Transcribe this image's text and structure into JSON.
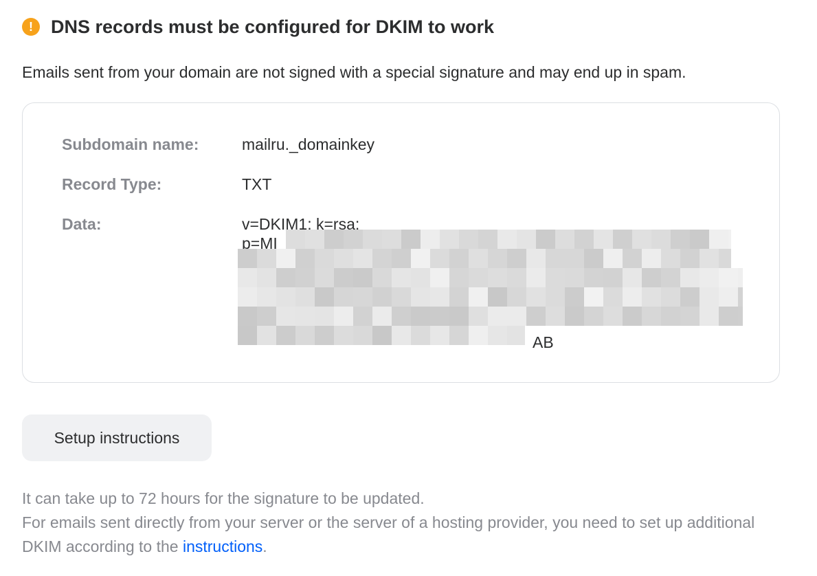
{
  "alert": {
    "icon": "warning-circle-icon",
    "icon_glyph": "!",
    "icon_color": "#f7a21b",
    "title": "DNS records must be configured for DKIM to work"
  },
  "description": "Emails sent from your domain are not signed with a special signature and may end up in spam.",
  "record": {
    "subdomain_label": "Subdomain name:",
    "subdomain_value": "mailru._domainkey",
    "type_label": "Record Type:",
    "type_value": "TXT",
    "data_label": "Data:",
    "data_line_1": "v=DKIM1; k=rsa;",
    "data_line_2_visible": "p=MI",
    "data_tail_visible": "AB"
  },
  "button": {
    "setup_label": "Setup instructions"
  },
  "footer": {
    "line_1": "It can take up to 72 hours for the signature to be updated.",
    "line_2_before_link": "For emails sent directly from your server or the server of a hosting provider, you need to set up additional DKIM according to the ",
    "link_text": "instructions",
    "line_2_after_link": "."
  },
  "colors": {
    "text_primary": "#2c2d2e",
    "text_secondary": "#87898f",
    "link": "#005ff9",
    "button_bg": "#f0f1f3",
    "card_border": "#dcdfe3"
  }
}
